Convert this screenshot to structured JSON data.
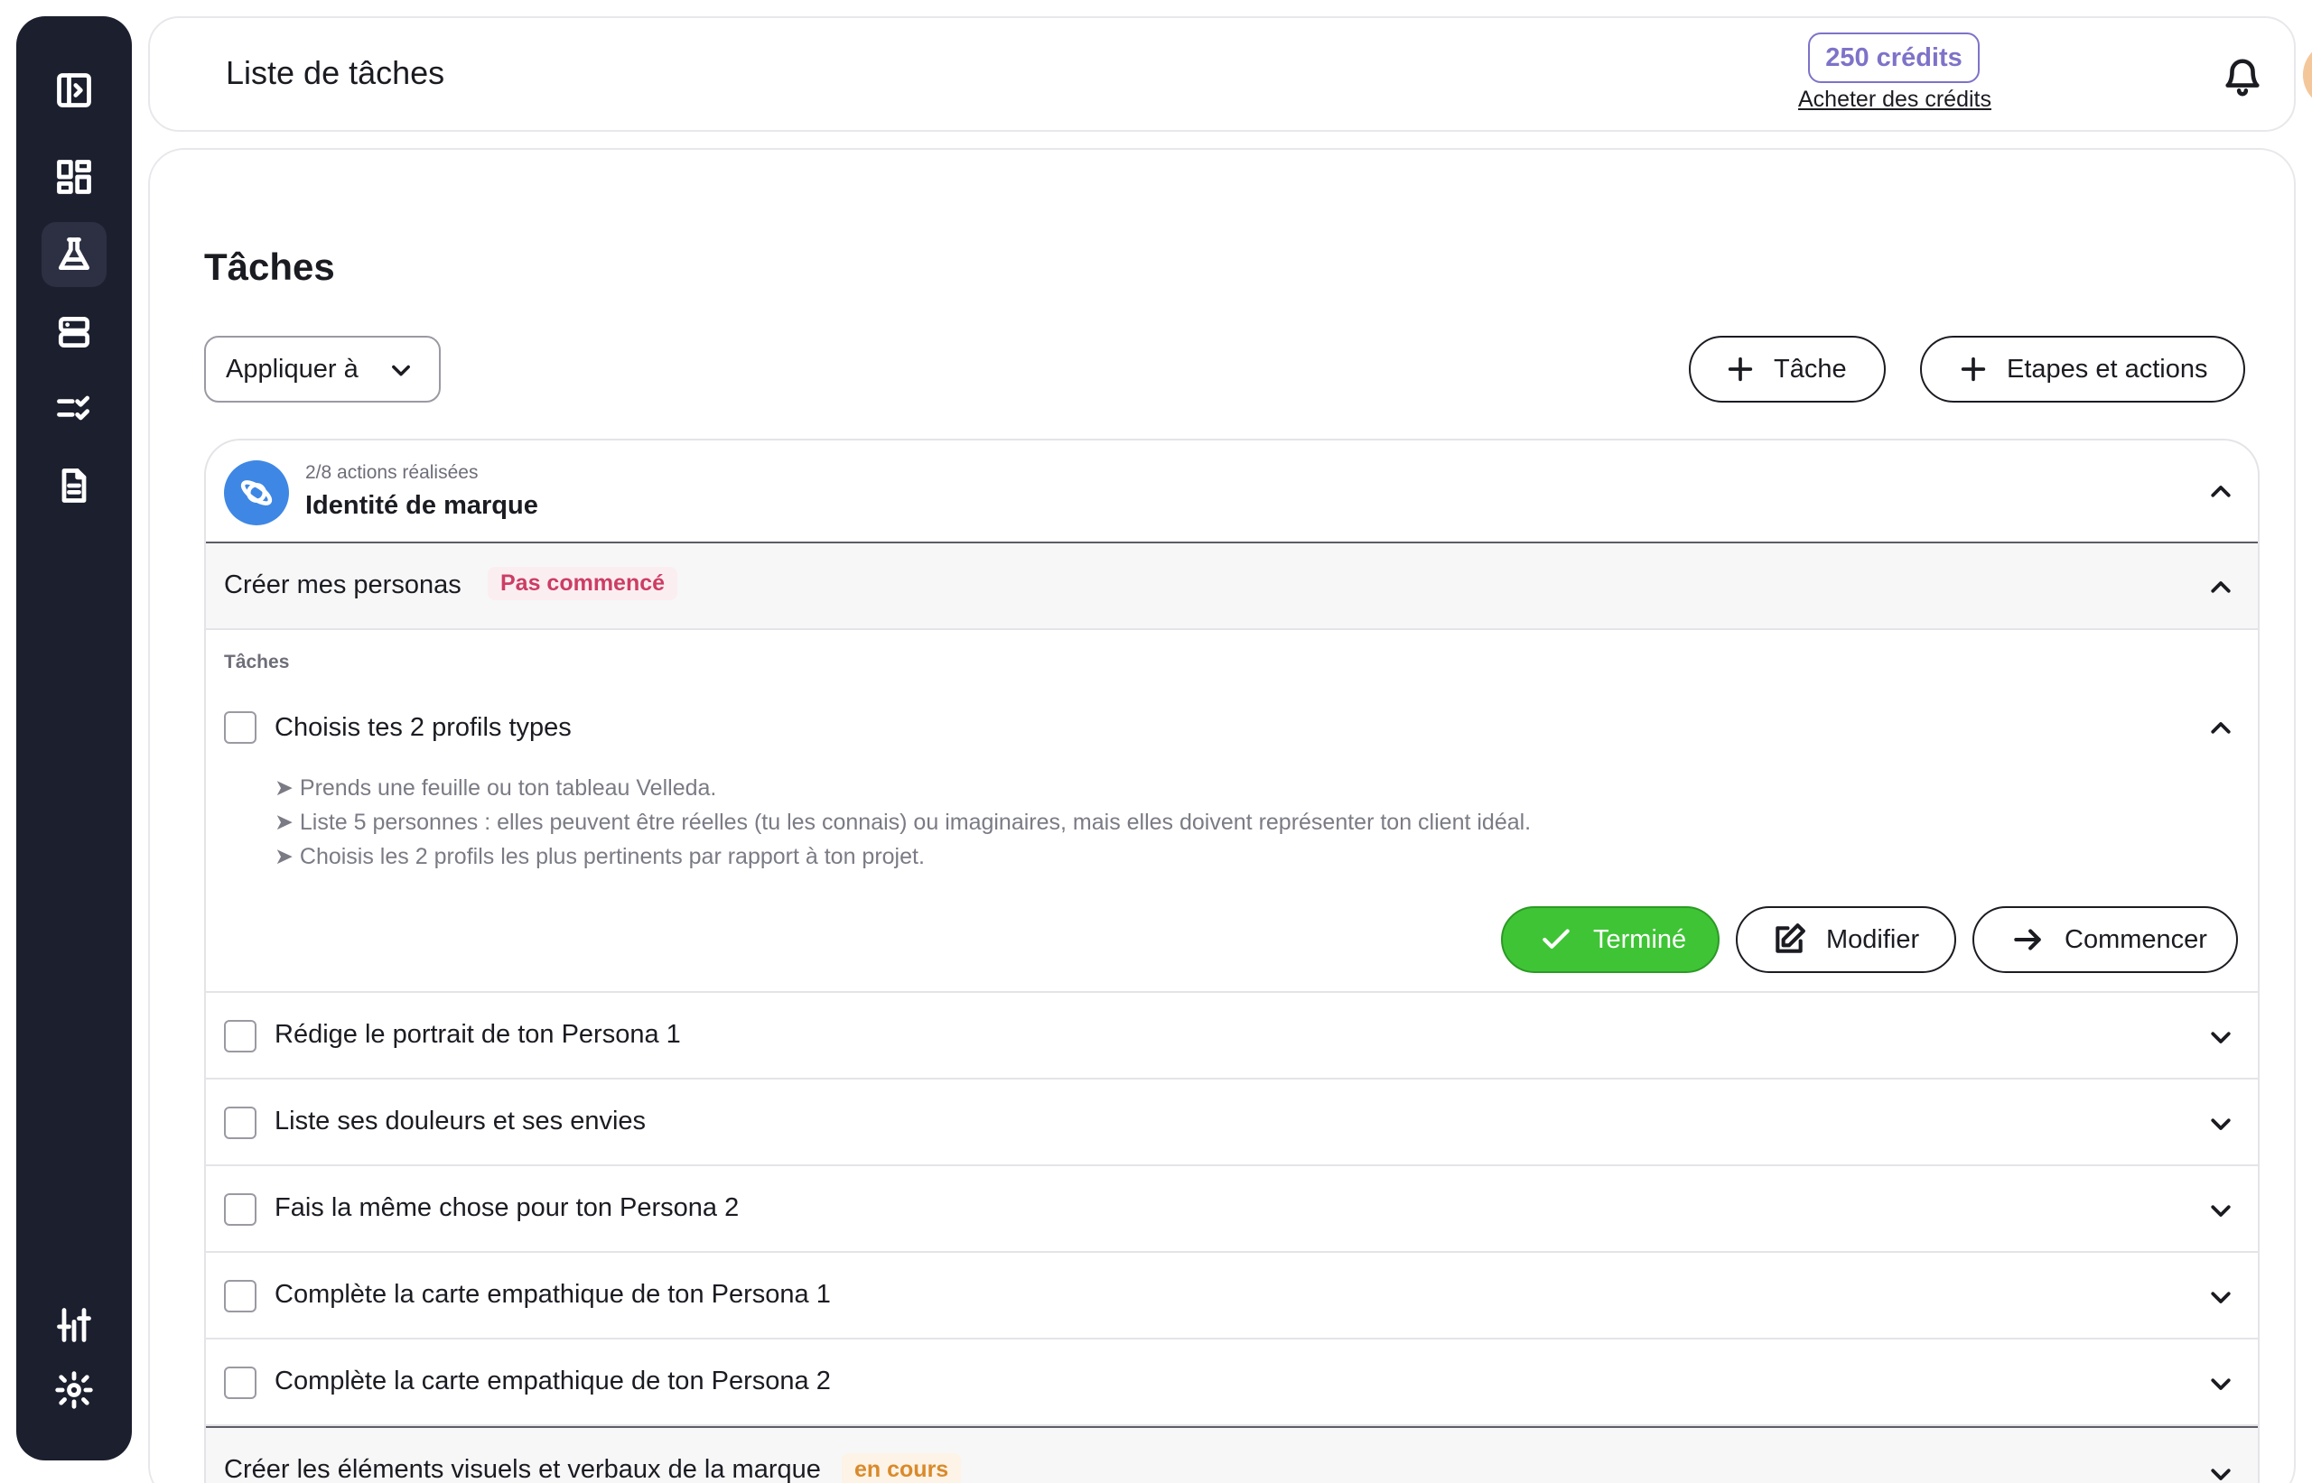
{
  "sidebar": {
    "icons": [
      "sidebar-toggle-icon",
      "dashboard-icon",
      "flask-icon",
      "server-icon",
      "checklist-icon",
      "document-icon",
      "sliders-icon",
      "gear-icon"
    ]
  },
  "header": {
    "title": "Liste de tâches",
    "credits": "250 crédits",
    "buy_credits": "Acheter des crédits"
  },
  "main": {
    "section_title": "Tâches",
    "apply_select": "Appliquer à",
    "add_task_label": "Tâche",
    "add_steps_label": "Etapes et actions",
    "group": {
      "progress": "2/8 actions réalisées",
      "name": "Identité de marque"
    },
    "step": {
      "title": "Créer mes personas",
      "status": "Pas commencé",
      "tasks_label": "Tâches"
    },
    "open_task": {
      "title": "Choisis tes 2 profils types",
      "desc1": "➤ Prends une feuille ou ton tableau Velleda.",
      "desc2": "➤ Liste 5 personnes : elles peuvent être réelles (tu les connais) ou imaginaires, mais elles doivent représenter ton client idéal.",
      "desc3": "➤ Choisis les 2 profils les plus pertinents par rapport à ton projet.",
      "done_label": "Terminé",
      "edit_label": "Modifier",
      "start_label": "Commencer"
    },
    "tasks": [
      "Rédige le portrait de ton Persona 1",
      "Liste ses douleurs et ses envies",
      "Fais la même chose pour ton Persona 2",
      "Complète la carte empathique de ton Persona 1",
      "Complète la carte empathique de ton Persona 2"
    ],
    "next_step": {
      "title": "Créer les éléments visuels et verbaux de la marque",
      "status": "en cours"
    }
  },
  "colors": {
    "sidebar_bg": "#1c1f2e",
    "credits_accent": "#7d73c9",
    "done_green": "#3fc436",
    "status_not_started": "#cc3d64",
    "status_in_progress": "#d98a2b",
    "group_icon_blue": "#3e87e4"
  }
}
